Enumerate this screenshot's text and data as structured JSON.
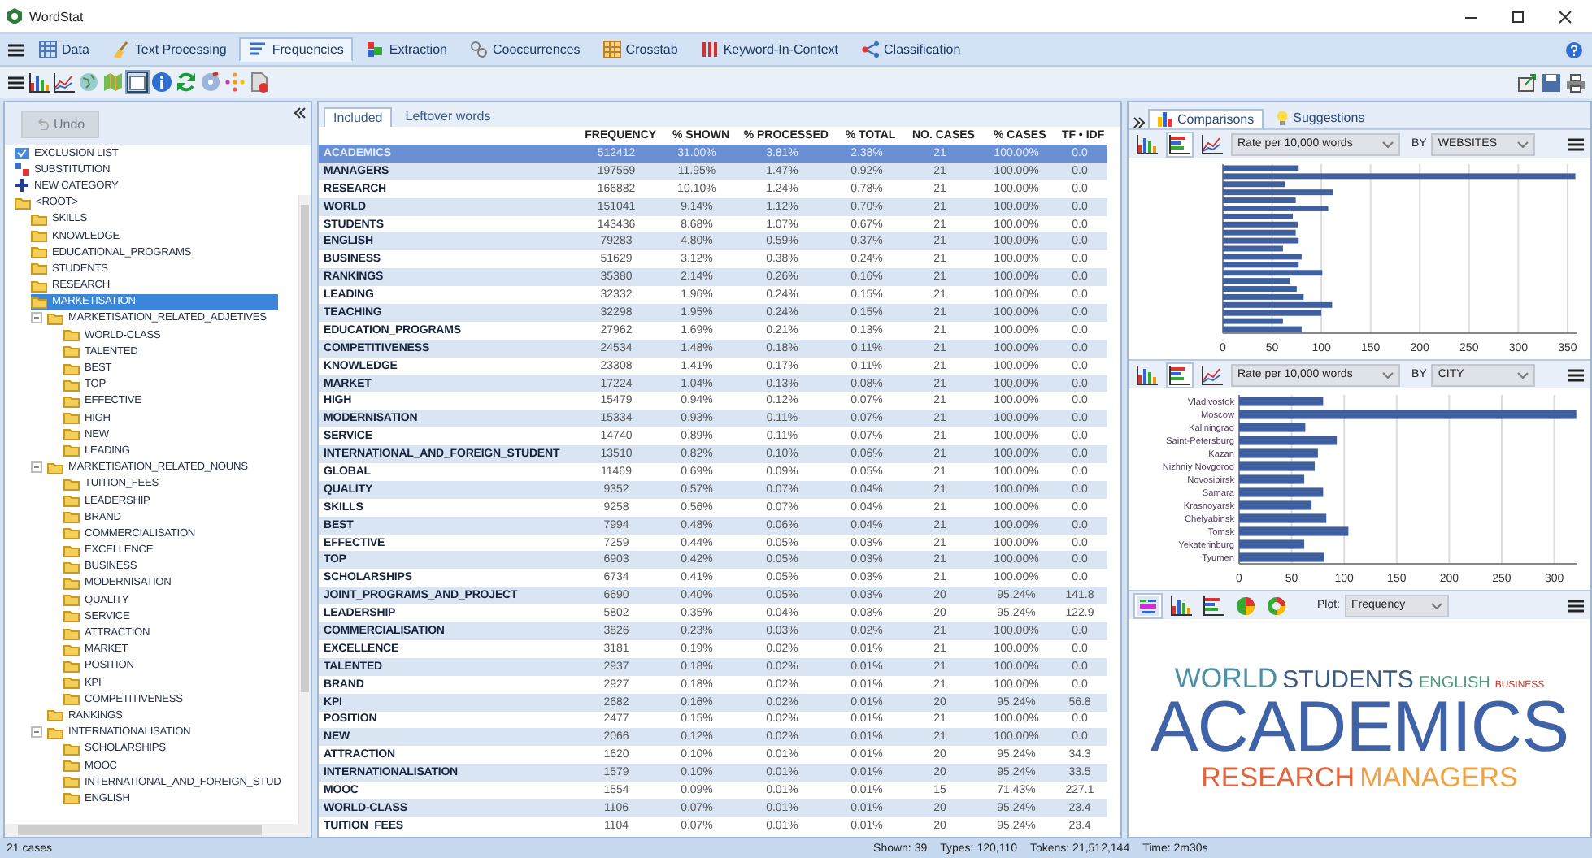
{
  "window": {
    "title": "WordStat"
  },
  "main_tabs": [
    {
      "label": "Data",
      "selected": false
    },
    {
      "label": "Text Processing",
      "selected": false
    },
    {
      "label": "Frequencies",
      "selected": true
    },
    {
      "label": "Extraction",
      "selected": false
    },
    {
      "label": "Cooccurrences",
      "selected": false
    },
    {
      "label": "Crosstab",
      "selected": false
    },
    {
      "label": "Keyword-In-Context",
      "selected": false
    },
    {
      "label": "Classification",
      "selected": false
    }
  ],
  "undo_button": {
    "label": "Undo",
    "disabled": true
  },
  "category_actions": [
    {
      "label": "EXCLUSION LIST",
      "kind": "exclusion"
    },
    {
      "label": "SUBSTITUTION",
      "kind": "substitution"
    },
    {
      "label": "NEW CATEGORY",
      "kind": "new"
    }
  ],
  "tree": {
    "categories": [
      {
        "label": "<ROOT>",
        "selected": false,
        "children": [
          {
            "label": "SKILLS",
            "selected": false
          },
          {
            "label": "KNOWLEDGE",
            "selected": false
          },
          {
            "label": "EDUCATIONAL_PROGRAMS",
            "selected": false
          },
          {
            "label": "STUDENTS",
            "selected": false
          },
          {
            "label": "RESEARCH",
            "selected": false
          },
          {
            "label": "MARKETISATION",
            "selected": true,
            "children": [
              {
                "label": "MARKETISATION_RELATED_ADJETIVES",
                "selected": false,
                "expanded": true,
                "children": [
                  {
                    "label": "WORLD-CLASS",
                    "selected": false
                  },
                  {
                    "label": "TALENTED",
                    "selected": false
                  },
                  {
                    "label": "BEST",
                    "selected": false
                  },
                  {
                    "label": "TOP",
                    "selected": false
                  },
                  {
                    "label": "EFFECTIVE",
                    "selected": false
                  },
                  {
                    "label": "HIGH",
                    "selected": false
                  },
                  {
                    "label": "NEW",
                    "selected": false
                  },
                  {
                    "label": "LEADING",
                    "selected": false
                  }
                ]
              },
              {
                "label": "MARKETISATION_RELATED_NOUNS",
                "selected": false,
                "expanded": true,
                "children": [
                  {
                    "label": "TUITION_FEES",
                    "selected": false
                  },
                  {
                    "label": "LEADERSHIP",
                    "selected": false
                  },
                  {
                    "label": "BRAND",
                    "selected": false
                  },
                  {
                    "label": "COMMERCIALISATION",
                    "selected": false
                  },
                  {
                    "label": "EXCELLENCE",
                    "selected": false
                  },
                  {
                    "label": "BUSINESS",
                    "selected": false
                  },
                  {
                    "label": "MODERNISATION",
                    "selected": false
                  },
                  {
                    "label": "QUALITY",
                    "selected": false
                  },
                  {
                    "label": "SERVICE",
                    "selected": false
                  },
                  {
                    "label": "ATTRACTION",
                    "selected": false
                  },
                  {
                    "label": "MARKET",
                    "selected": false
                  },
                  {
                    "label": "POSITION",
                    "selected": false
                  },
                  {
                    "label": "KPI",
                    "selected": false
                  },
                  {
                    "label": "COMPETITIVENESS",
                    "selected": false
                  }
                ]
              },
              {
                "label": "RANKINGS",
                "selected": false
              },
              {
                "label": "INTERNATIONALISATION",
                "selected": false,
                "expanded": true,
                "children": [
                  {
                    "label": "SCHOLARSHIPS",
                    "selected": false
                  },
                  {
                    "label": "MOOC",
                    "selected": false
                  },
                  {
                    "label": "INTERNATIONAL_AND_FOREIGN_STUD",
                    "selected": false
                  },
                  {
                    "label": "ENGLISH",
                    "selected": false
                  }
                ]
              }
            ]
          }
        ]
      }
    ]
  },
  "table": {
    "tabs": [
      {
        "label": "Included",
        "selected": true
      },
      {
        "label": "Leftover words",
        "selected": false
      }
    ],
    "columns": [
      "",
      "FREQUENCY",
      "% SHOWN",
      "% PROCESSED",
      "% TOTAL",
      "NO. CASES",
      "% CASES",
      "TF • IDF"
    ],
    "rows": [
      {
        "selected": true,
        "cells": [
          "ACADEMICS",
          "512412",
          "31.00%",
          "3.81%",
          "2.38%",
          "21",
          "100.00%",
          "0.0"
        ]
      },
      {
        "selected": false,
        "cells": [
          "MANAGERS",
          "197559",
          "11.95%",
          "1.47%",
          "0.92%",
          "21",
          "100.00%",
          "0.0"
        ]
      },
      {
        "selected": false,
        "cells": [
          "RESEARCH",
          "166882",
          "10.10%",
          "1.24%",
          "0.78%",
          "21",
          "100.00%",
          "0.0"
        ]
      },
      {
        "selected": false,
        "cells": [
          "WORLD",
          "151041",
          "9.14%",
          "1.12%",
          "0.70%",
          "21",
          "100.00%",
          "0.0"
        ]
      },
      {
        "selected": false,
        "cells": [
          "STUDENTS",
          "143436",
          "8.68%",
          "1.07%",
          "0.67%",
          "21",
          "100.00%",
          "0.0"
        ]
      },
      {
        "selected": false,
        "cells": [
          "ENGLISH",
          "79283",
          "4.80%",
          "0.59%",
          "0.37%",
          "21",
          "100.00%",
          "0.0"
        ]
      },
      {
        "selected": false,
        "cells": [
          "BUSINESS",
          "51629",
          "3.12%",
          "0.38%",
          "0.24%",
          "21",
          "100.00%",
          "0.0"
        ]
      },
      {
        "selected": false,
        "cells": [
          "RANKINGS",
          "35380",
          "2.14%",
          "0.26%",
          "0.16%",
          "21",
          "100.00%",
          "0.0"
        ]
      },
      {
        "selected": false,
        "cells": [
          "LEADING",
          "32332",
          "1.96%",
          "0.24%",
          "0.15%",
          "21",
          "100.00%",
          "0.0"
        ]
      },
      {
        "selected": false,
        "cells": [
          "TEACHING",
          "32298",
          "1.95%",
          "0.24%",
          "0.15%",
          "21",
          "100.00%",
          "0.0"
        ]
      },
      {
        "selected": false,
        "cells": [
          "EDUCATION_PROGRAMS",
          "27962",
          "1.69%",
          "0.21%",
          "0.13%",
          "21",
          "100.00%",
          "0.0"
        ]
      },
      {
        "selected": false,
        "cells": [
          "COMPETITIVENESS",
          "24534",
          "1.48%",
          "0.18%",
          "0.11%",
          "21",
          "100.00%",
          "0.0"
        ]
      },
      {
        "selected": false,
        "cells": [
          "KNOWLEDGE",
          "23308",
          "1.41%",
          "0.17%",
          "0.11%",
          "21",
          "100.00%",
          "0.0"
        ]
      },
      {
        "selected": false,
        "cells": [
          "MARKET",
          "17224",
          "1.04%",
          "0.13%",
          "0.08%",
          "21",
          "100.00%",
          "0.0"
        ]
      },
      {
        "selected": false,
        "cells": [
          "HIGH",
          "15479",
          "0.94%",
          "0.12%",
          "0.07%",
          "21",
          "100.00%",
          "0.0"
        ]
      },
      {
        "selected": false,
        "cells": [
          "MODERNISATION",
          "15334",
          "0.93%",
          "0.11%",
          "0.07%",
          "21",
          "100.00%",
          "0.0"
        ]
      },
      {
        "selected": false,
        "cells": [
          "SERVICE",
          "14740",
          "0.89%",
          "0.11%",
          "0.07%",
          "21",
          "100.00%",
          "0.0"
        ]
      },
      {
        "selected": false,
        "cells": [
          "INTERNATIONAL_AND_FOREIGN_STUDENT",
          "13510",
          "0.82%",
          "0.10%",
          "0.06%",
          "21",
          "100.00%",
          "0.0"
        ]
      },
      {
        "selected": false,
        "cells": [
          "GLOBAL",
          "11469",
          "0.69%",
          "0.09%",
          "0.05%",
          "21",
          "100.00%",
          "0.0"
        ]
      },
      {
        "selected": false,
        "cells": [
          "QUALITY",
          "9352",
          "0.57%",
          "0.07%",
          "0.04%",
          "21",
          "100.00%",
          "0.0"
        ]
      },
      {
        "selected": false,
        "cells": [
          "SKILLS",
          "9258",
          "0.56%",
          "0.07%",
          "0.04%",
          "21",
          "100.00%",
          "0.0"
        ]
      },
      {
        "selected": false,
        "cells": [
          "BEST",
          "7994",
          "0.48%",
          "0.06%",
          "0.04%",
          "21",
          "100.00%",
          "0.0"
        ]
      },
      {
        "selected": false,
        "cells": [
          "EFFECTIVE",
          "7259",
          "0.44%",
          "0.05%",
          "0.03%",
          "21",
          "100.00%",
          "0.0"
        ]
      },
      {
        "selected": false,
        "cells": [
          "TOP",
          "6903",
          "0.42%",
          "0.05%",
          "0.03%",
          "21",
          "100.00%",
          "0.0"
        ]
      },
      {
        "selected": false,
        "cells": [
          "SCHOLARSHIPS",
          "6734",
          "0.41%",
          "0.05%",
          "0.03%",
          "21",
          "100.00%",
          "0.0"
        ]
      },
      {
        "selected": false,
        "cells": [
          "JOINT_PROGRAMS_AND_PROJECT",
          "6690",
          "0.40%",
          "0.05%",
          "0.03%",
          "20",
          "95.24%",
          "141.8"
        ]
      },
      {
        "selected": false,
        "cells": [
          "LEADERSHIP",
          "5802",
          "0.35%",
          "0.04%",
          "0.03%",
          "20",
          "95.24%",
          "122.9"
        ]
      },
      {
        "selected": false,
        "cells": [
          "COMMERCIALISATION",
          "3826",
          "0.23%",
          "0.03%",
          "0.02%",
          "21",
          "100.00%",
          "0.0"
        ]
      },
      {
        "selected": false,
        "cells": [
          "EXCELLENCE",
          "3181",
          "0.19%",
          "0.02%",
          "0.01%",
          "21",
          "100.00%",
          "0.0"
        ]
      },
      {
        "selected": false,
        "cells": [
          "TALENTED",
          "2937",
          "0.18%",
          "0.02%",
          "0.01%",
          "21",
          "100.00%",
          "0.0"
        ]
      },
      {
        "selected": false,
        "cells": [
          "BRAND",
          "2927",
          "0.18%",
          "0.02%",
          "0.01%",
          "21",
          "100.00%",
          "0.0"
        ]
      },
      {
        "selected": false,
        "cells": [
          "KPI",
          "2682",
          "0.16%",
          "0.02%",
          "0.01%",
          "20",
          "95.24%",
          "56.8"
        ]
      },
      {
        "selected": false,
        "cells": [
          "POSITION",
          "2477",
          "0.15%",
          "0.02%",
          "0.01%",
          "21",
          "100.00%",
          "0.0"
        ]
      },
      {
        "selected": false,
        "cells": [
          "NEW",
          "2066",
          "0.12%",
          "0.02%",
          "0.01%",
          "21",
          "100.00%",
          "0.0"
        ]
      },
      {
        "selected": false,
        "cells": [
          "ATTRACTION",
          "1620",
          "0.10%",
          "0.01%",
          "0.01%",
          "20",
          "95.24%",
          "34.3"
        ]
      },
      {
        "selected": false,
        "cells": [
          "INTERNATIONALISATION",
          "1579",
          "0.10%",
          "0.01%",
          "0.01%",
          "20",
          "95.24%",
          "33.5"
        ]
      },
      {
        "selected": false,
        "cells": [
          "MOOC",
          "1554",
          "0.09%",
          "0.01%",
          "0.01%",
          "15",
          "71.43%",
          "227.1"
        ]
      },
      {
        "selected": false,
        "cells": [
          "WORLD-CLASS",
          "1106",
          "0.07%",
          "0.01%",
          "0.01%",
          "20",
          "95.24%",
          "23.4"
        ]
      },
      {
        "selected": false,
        "cells": [
          "TUITION_FEES",
          "1104",
          "0.07%",
          "0.01%",
          "0.01%",
          "20",
          "95.24%",
          "23.4"
        ]
      }
    ]
  },
  "side": {
    "tabs": [
      {
        "label": "Comparisons",
        "selected": true
      },
      {
        "label": "Suggestions",
        "selected": false
      }
    ],
    "panels": [
      {
        "chart_types": [
          {
            "kind": "column",
            "selected": false
          },
          {
            "kind": "bar",
            "selected": true
          },
          {
            "kind": "line",
            "selected": false
          }
        ],
        "measure": "Rate per 10,000 words",
        "by_label": "BY",
        "by": "WEBSITES",
        "chart_data": {
          "type": "bar",
          "orientation": "horizontal",
          "grid": true,
          "xlim": [
            0,
            360
          ],
          "xticks": [
            0,
            50,
            100,
            150,
            200,
            250,
            300,
            350
          ],
          "series": [
            {
              "color": "#3f5f9f",
              "values": [
                77,
                358,
                63,
                112,
                74,
                107,
                71,
                76,
                74,
                77,
                61,
                80,
                77,
                101,
                68,
                75,
                82,
                111,
                100,
                61,
                80
              ]
            }
          ]
        }
      },
      {
        "chart_types": [
          {
            "kind": "column",
            "selected": false
          },
          {
            "kind": "bar",
            "selected": true
          },
          {
            "kind": "line",
            "selected": false
          }
        ],
        "measure": "Rate per 10,000 words",
        "by_label": "BY",
        "by": "CITY",
        "chart_data": {
          "type": "bar",
          "orientation": "horizontal",
          "grid": true,
          "xlim": [
            0,
            322
          ],
          "xticks": [
            0,
            50,
            100,
            150,
            200,
            250,
            300
          ],
          "categories": [
            "Vladivostok",
            "Moscow",
            "Kaliningrad",
            "Saint-Petersburg",
            "Kazan",
            "Nizhniy Novgorod",
            "Novosibirsk",
            "Samara",
            "Krasnoyarsk",
            "Chelyabinsk",
            "Tomsk",
            "Yekaterinburg",
            "Tyumen"
          ],
          "series": [
            {
              "color": "#3f5f9f",
              "values": [
                80,
                321,
                63,
                93,
                75,
                72,
                62,
                80,
                69,
                83,
                104,
                62,
                81
              ]
            }
          ]
        }
      }
    ],
    "word_cloud": {
      "view_types": [
        {
          "kind": "cloud",
          "selected": true
        },
        {
          "kind": "column",
          "selected": false
        },
        {
          "kind": "bar",
          "selected": false
        },
        {
          "kind": "pie",
          "selected": false
        },
        {
          "kind": "donut",
          "selected": false
        }
      ],
      "plot_label": "Plot:",
      "plot": "Frequency",
      "lines": [
        [
          {
            "text": "WORLD",
            "kind": "l",
            "color": "#4d8fa6"
          },
          {
            "text": "STUDENTS",
            "kind": "m",
            "color": "#3b5a82"
          },
          {
            "text": "ENGLISH",
            "kind": "s",
            "color": "#4f9a7e"
          },
          {
            "text": "BUSINESS",
            "kind": "xs",
            "color": "#c0392b"
          }
        ],
        [
          {
            "text": "ACADEMICS",
            "kind": "xl",
            "color": "#3f63a6"
          }
        ],
        [
          {
            "text": "RESEARCH",
            "kind": "l",
            "color": "#e4633a"
          },
          {
            "text": "MANAGERS",
            "kind": "l",
            "color": "#f0a243"
          }
        ]
      ]
    }
  },
  "status_bar": {
    "cases": "21 cases",
    "items": [
      "Shown: 39",
      "Types: 120,110",
      "Tokens: 21,512,144",
      "Time: 2m30s"
    ]
  }
}
